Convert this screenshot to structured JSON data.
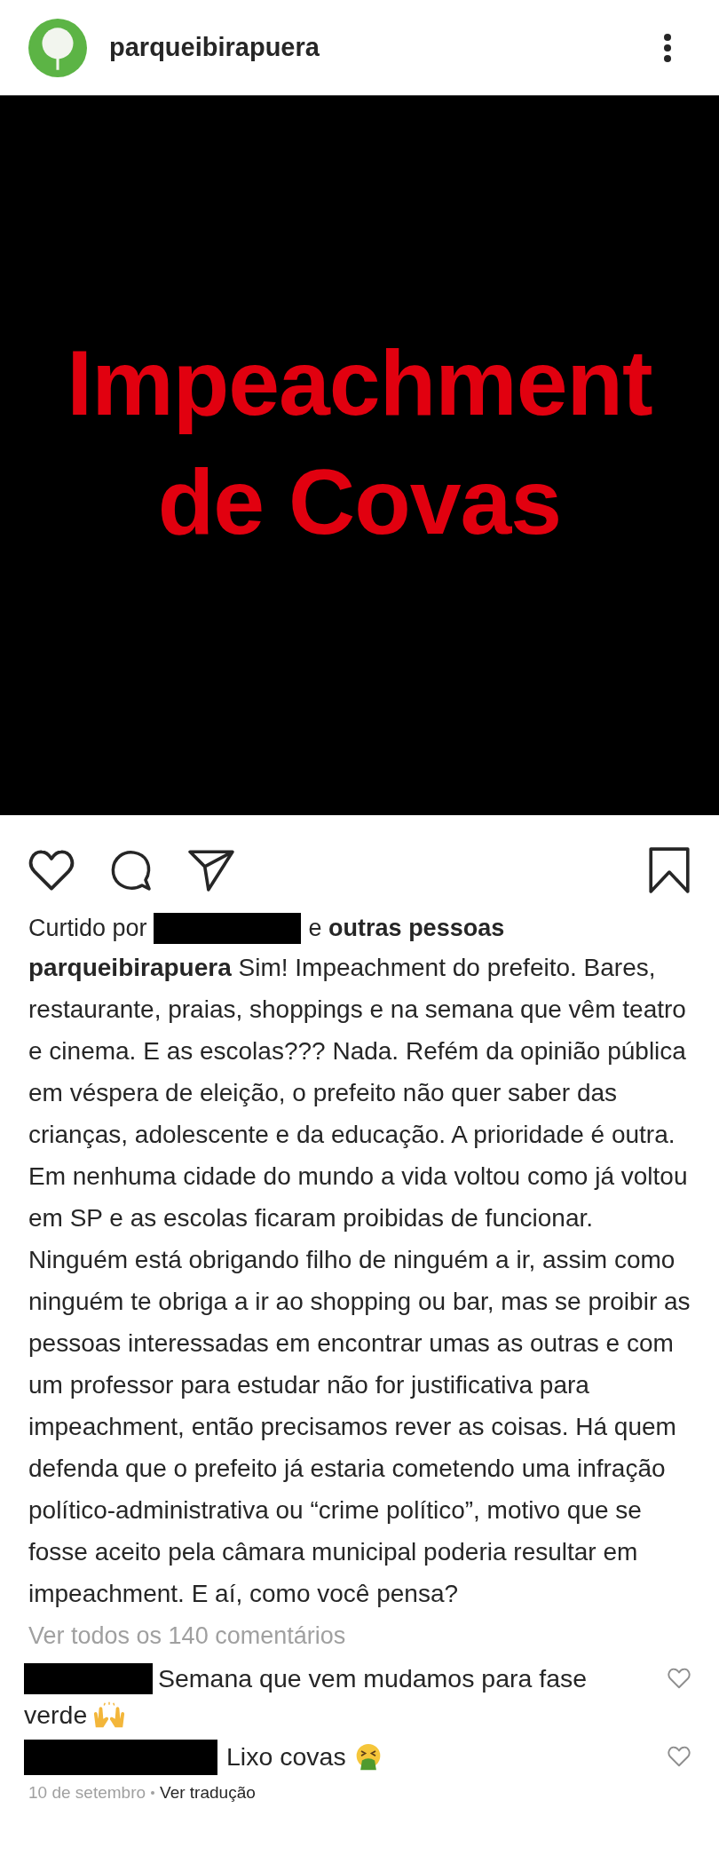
{
  "header": {
    "username": "parqueibirapuera"
  },
  "post_image": {
    "text_lines": [
      "Impeachment",
      "de Covas"
    ]
  },
  "actions": {
    "liked": false,
    "saved": false
  },
  "likes": {
    "prefix": "Curtido por",
    "rest": "e **outras pessoas**"
  },
  "caption": "**parqueibirapuera** Sim! Impeachment do prefeito. Bares, restaurante, praias, shoppings e na semana que vêm teatro e cinema. E as escolas??? Nada. Refém da opinião pública em véspera de eleição, o prefeito não quer saber das crianças, adolescente e da educação. A prioridade é outra. Em nenhuma cidade do mundo a vida voltou como já voltou em SP e as escolas ficaram proibidas de funcionar. Ninguém está obrigando filho de ninguém a ir, assim como ninguém te obriga a ir ao shopping ou bar, mas se proibir as pessoas interessadas em encontrar umas as outras e com um professor para estudar não for justificativa para impeachment, então precisamos rever as coisas. Há quem defenda que o prefeito já estaria cometendo uma infração político-administrativa ou “crime político”, motivo que se fosse aceito pela câmara municipal poderia resultar em impeachment. E aí, como você pensa?",
  "view_all": "Ver todos os 140 comentários",
  "comments": [
    {
      "lines": [
        "Semana que vem mudamos para fase",
        "verde"
      ],
      "kind": "raised_hands",
      "liked": false
    },
    {
      "lines": [
        "Lixo covas"
      ],
      "kind": "vomiting",
      "liked": false
    }
  ],
  "footer": {
    "date": "10 de setembro",
    "translate": "Ver tradução"
  }
}
